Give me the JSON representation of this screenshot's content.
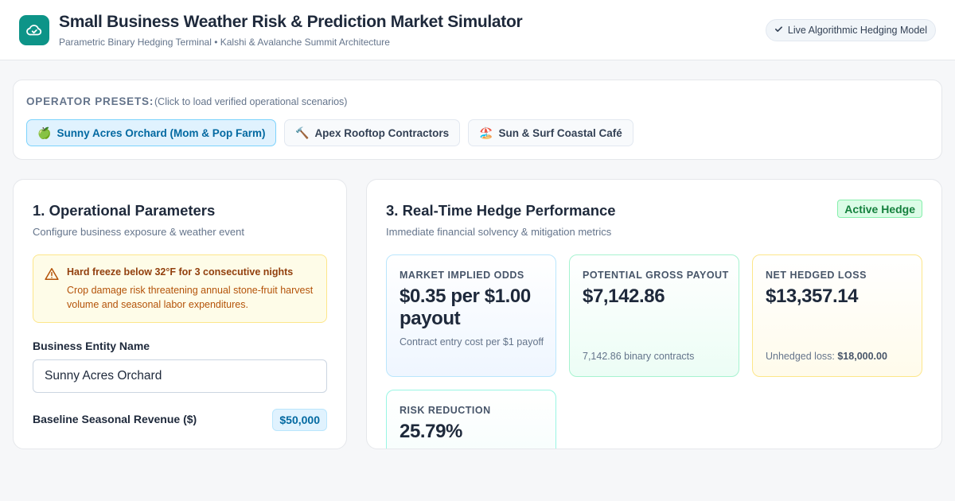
{
  "header": {
    "title": "Small Business Weather Risk & Prediction Market Simulator",
    "subtitle": "Parametric Binary Hedging Terminal • Kalshi & Avalanche Summit Architecture",
    "status_pill": "Live Algorithmic Hedging Model",
    "logo_icon": "cloud-icon",
    "accent_color": "#0d9488"
  },
  "presets": {
    "label": "OPERATOR PRESETS:",
    "hint": "(Click to load verified operational scenarios)",
    "items": [
      {
        "emoji": "🍏",
        "label": "Sunny Acres Orchard (Mom & Pop Farm)",
        "active": true
      },
      {
        "emoji": "🔨",
        "label": "Apex Rooftop Contractors",
        "active": false
      },
      {
        "emoji": "🏖️",
        "label": "Sun & Surf Coastal Café",
        "active": false
      }
    ]
  },
  "operational": {
    "title": "1. Operational Parameters",
    "subtitle": "Configure business exposure & weather event",
    "alert": {
      "icon": "warning-icon",
      "title": "Hard freeze below 32°F for 3 consecutive nights",
      "body": "Crop damage risk threatening annual stone-fruit harvest volume and seasonal labor expenditures."
    },
    "entity_label": "Business Entity Name",
    "entity_value": "Sunny Acres Orchard",
    "revenue_label": "Baseline Seasonal Revenue ($)",
    "revenue_value": "$50,000"
  },
  "performance": {
    "title": "3. Real-Time Hedge Performance",
    "subtitle": "Immediate financial solvency & mitigation metrics",
    "badge": "Active Hedge",
    "metrics": {
      "odds": {
        "label": "MARKET IMPLIED ODDS",
        "value": "$0.35 per $1.00 payout",
        "note": "Contract entry cost per $1 payoff"
      },
      "payout": {
        "label": "POTENTIAL GROSS PAYOUT",
        "value": "$7,142.86",
        "note": "7,142.86 binary contracts"
      },
      "loss": {
        "label": "NET HEDGED LOSS",
        "value": "$13,357.14",
        "note_prefix": "Unhedged loss:",
        "note_value": "$18,000.00"
      },
      "risk": {
        "label": "RISK REDUCTION",
        "value": "25.79%"
      }
    }
  }
}
